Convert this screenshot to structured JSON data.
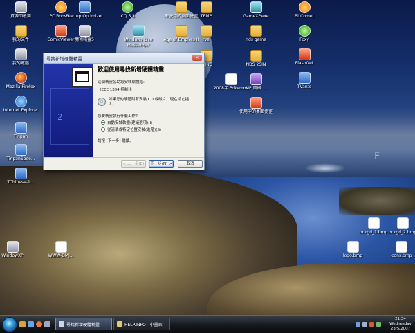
{
  "desktop_icons": [
    {
      "label": "資源回收筒",
      "icon": "recycle-bin-icon"
    },
    {
      "label": "我的文件",
      "icon": "my-documents-icon"
    },
    {
      "label": "我的電腦",
      "icon": "my-computer-icon"
    },
    {
      "label": "Mozilla Firefox",
      "icon": "firefox-icon"
    },
    {
      "label": "Internet Explorer",
      "icon": "internet-explorer-icon"
    },
    {
      "label": "Tinpan",
      "icon": "tinpan-icon"
    },
    {
      "label": "TinpanSpee...",
      "icon": "tinpan-speed-icon"
    },
    {
      "label": "TChinese-1...",
      "icon": "tchinese-installer-icon"
    },
    {
      "label": "WindowXP",
      "icon": "windowxp-icon"
    },
    {
      "label": "PC Booster",
      "icon": "pc-booster-icon"
    },
    {
      "label": "Startup Optimizer",
      "icon": "startup-optimizer-icon"
    },
    {
      "label": "ComicViewer",
      "icon": "comicviewer-icon"
    },
    {
      "label": "魔術精靈5",
      "icon": "magic-wizard-icon"
    },
    {
      "label": "WWW-DMJ...",
      "icon": "document-icon"
    },
    {
      "label": "ICQ 5.1",
      "icon": "icq-icon"
    },
    {
      "label": "Windows Live Messenger",
      "icon": "messenger-icon"
    },
    {
      "label": "未使用的桌面捷徑",
      "icon": "folder-icon"
    },
    {
      "label": "Age of Empires II",
      "icon": "age-of-empires-icon"
    },
    {
      "label": "rve",
      "icon": "folder-icon"
    },
    {
      "label": "UTINO",
      "icon": "folder-icon"
    },
    {
      "label": "TEMP",
      "icon": "folder-icon"
    },
    {
      "label": "2008年 Pokemon",
      "icon": "pokemon-icon"
    },
    {
      "label": "GameXP.exe",
      "icon": "gamexp-icon"
    },
    {
      "label": "nds game",
      "icon": "folder-icon"
    },
    {
      "label": "NDS 2SIN",
      "icon": "folder-icon"
    },
    {
      "label": "MP 風格 ...",
      "icon": "mp-style-icon"
    },
    {
      "label": "使用中的桌面捷徑",
      "icon": "active-shortcut-icon"
    },
    {
      "label": "BitComet",
      "icon": "bitcomet-icon"
    },
    {
      "label": "Foxy",
      "icon": "foxy-icon"
    },
    {
      "label": "FlashGet",
      "icon": "flashget-icon"
    },
    {
      "label": "TVants",
      "icon": "tvants-icon"
    },
    {
      "label": "bckgd_1.bmp",
      "icon": "bitmap-file-icon"
    },
    {
      "label": "bckgd_2.bmp",
      "icon": "bitmap-file-icon"
    },
    {
      "label": "logo.bmp",
      "icon": "bitmap-file-icon"
    },
    {
      "label": "icons.bmp",
      "icon": "bitmap-file-icon"
    }
  ],
  "background_letter": "F",
  "wizard": {
    "window_title": "尋找新增硬體精靈",
    "close_glyph": "×",
    "side_number": "2",
    "heading": "歡迎使用尋找新增硬體精靈",
    "intro": "這個精靈協助您安裝軟體給:",
    "device_name": "IEEE 1394 控制卡",
    "cd_prompt": "如果您的硬體附有安裝 CD 或磁片，現在請它插入。",
    "question": "您要精靈執行什麼工作?",
    "options": [
      {
        "label": "自動安裝軟體(建議選項)(I)",
        "selected": true
      },
      {
        "label": "從清單或特定位置安裝(進階)(S)",
        "selected": false
      }
    ],
    "next_hint": "請按 [下一步] 繼續。",
    "buttons": {
      "back": "< 上一步(B)",
      "next": "下一步(N) >",
      "cancel": "取消"
    }
  },
  "taskbar": {
    "tasks": [
      {
        "label": "尋找新增硬體精靈",
        "active": true
      },
      {
        "label": "HELP.INFO - 小畫家",
        "active": false
      }
    ],
    "clock": {
      "time": "21:34",
      "day": "Wednesday",
      "date": "23/5/2007"
    }
  }
}
